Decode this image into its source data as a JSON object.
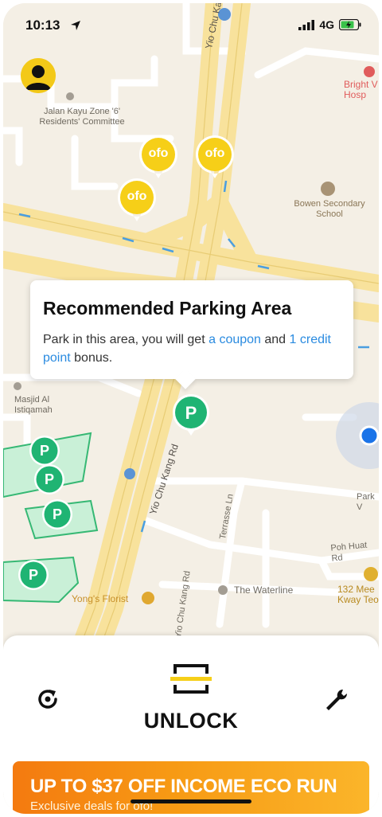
{
  "status_bar": {
    "time": "10:13",
    "network": "4G"
  },
  "map": {
    "roads": [
      "Yio Chu Kang Rd",
      "Yio Chu Kang Rd",
      "Yio Chu Kang Rd",
      "Terrasse Ln",
      "Poh Huat Rd",
      "Park V"
    ],
    "places": [
      "Jalan Kayu Zone '6' Residents' Committee",
      "Bright V Hosp",
      "Bowen Secondary School",
      "Masjid Al Istiqamah",
      "The Waterline",
      "Yong's Florist",
      "132 Mee Kway Teo"
    ],
    "bike_marker_label": "ofo",
    "parking_marker_label": "P"
  },
  "callout": {
    "title": "Recommended Parking Area",
    "text_1": "Park in this area, you will get ",
    "link_1": "a coupon",
    "text_2": " and ",
    "link_2": "1 credit point",
    "text_3": " bonus."
  },
  "panel": {
    "unlock_label": "UNLOCK",
    "banner_headline": "UP TO $37 OFF INCOME ECO RUN",
    "banner_sub": "Exclusive deals for ofo!"
  },
  "colors": {
    "brand_yellow": "#f6cf18",
    "parking_green": "#1fb473",
    "link_blue": "#2a8be0",
    "location_blue": "#1a73e8"
  },
  "icons": [
    "location-arrow-icon",
    "signal-icon",
    "battery-icon",
    "avatar-icon",
    "refresh-icon",
    "scan-unlock-icon",
    "wrench-icon"
  ]
}
